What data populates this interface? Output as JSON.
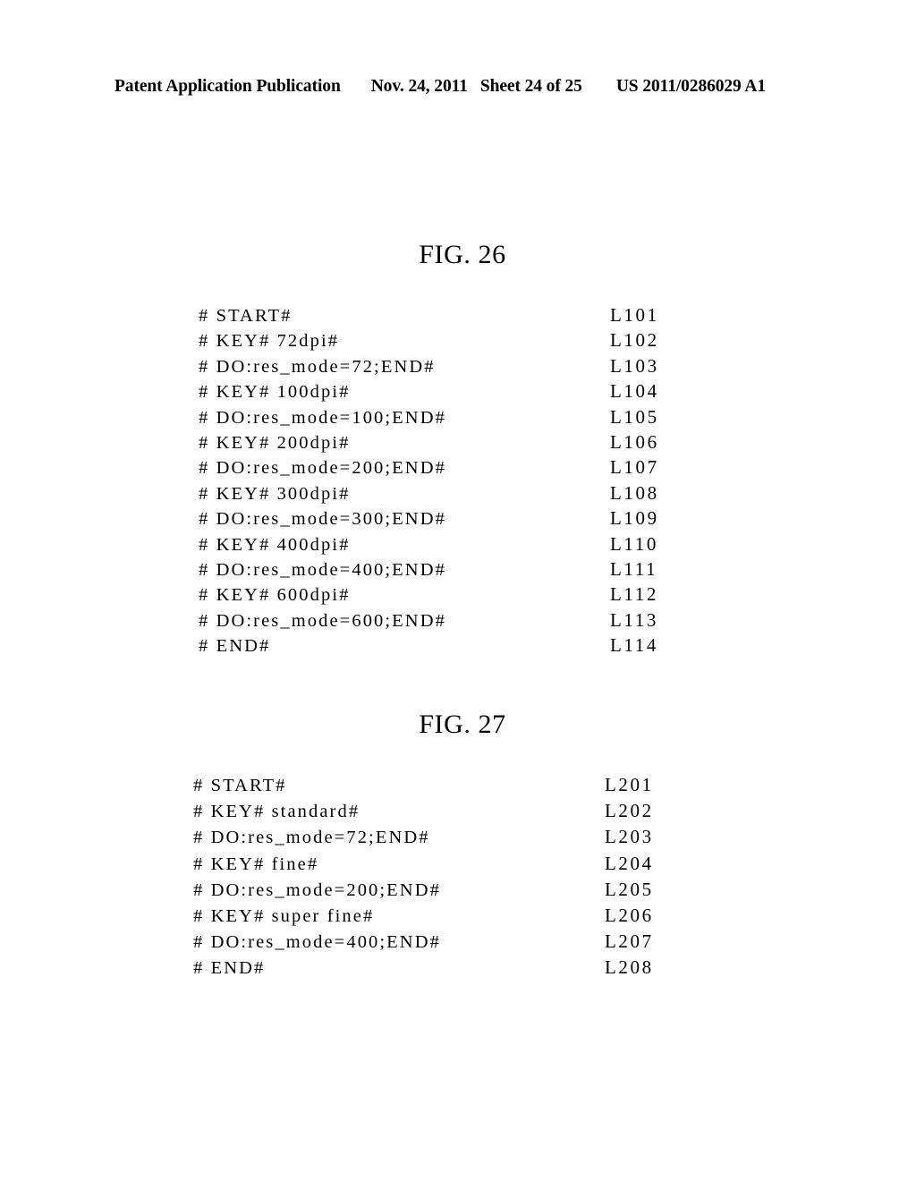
{
  "header": {
    "publication": "Patent Application Publication",
    "date": "Nov. 24, 2011",
    "sheet": "Sheet 24 of 25",
    "patent_number": "US 2011/0286029 A1"
  },
  "figures": [
    {
      "id": "figure-26",
      "title": "FIG. 26",
      "lines": [
        {
          "code": "# START#",
          "label": "L101"
        },
        {
          "code": "# KEY# 72dpi#",
          "label": "L102"
        },
        {
          "code": "# DO:res_mode=72;END#",
          "label": "L103"
        },
        {
          "code": "# KEY# 100dpi#",
          "label": "L104"
        },
        {
          "code": "# DO:res_mode=100;END#",
          "label": "L105"
        },
        {
          "code": "# KEY# 200dpi#",
          "label": "L106"
        },
        {
          "code": "# DO:res_mode=200;END#",
          "label": "L107"
        },
        {
          "code": "# KEY# 300dpi#",
          "label": "L108"
        },
        {
          "code": "# DO:res_mode=300;END#",
          "label": "L109"
        },
        {
          "code": "# KEY# 400dpi#",
          "label": "L110"
        },
        {
          "code": "# DO:res_mode=400;END#",
          "label": "L111"
        },
        {
          "code": "# KEY# 600dpi#",
          "label": "L112"
        },
        {
          "code": "# DO:res_mode=600;END#",
          "label": "L113"
        },
        {
          "code": "# END#",
          "label": "L114"
        }
      ]
    },
    {
      "id": "figure-27",
      "title": "FIG. 27",
      "lines": [
        {
          "code": "# START#",
          "label": "L201"
        },
        {
          "code": "# KEY# standard#",
          "label": "L202"
        },
        {
          "code": "# DO:res_mode=72;END#",
          "label": "L203"
        },
        {
          "code": "# KEY# fine#",
          "label": "L204"
        },
        {
          "code": "# DO:res_mode=200;END#",
          "label": "L205"
        },
        {
          "code": "# KEY# super fine#",
          "label": "L206"
        },
        {
          "code": "# DO:res_mode=400;END#",
          "label": "L207"
        },
        {
          "code": "# END#",
          "label": "L208"
        }
      ]
    }
  ]
}
